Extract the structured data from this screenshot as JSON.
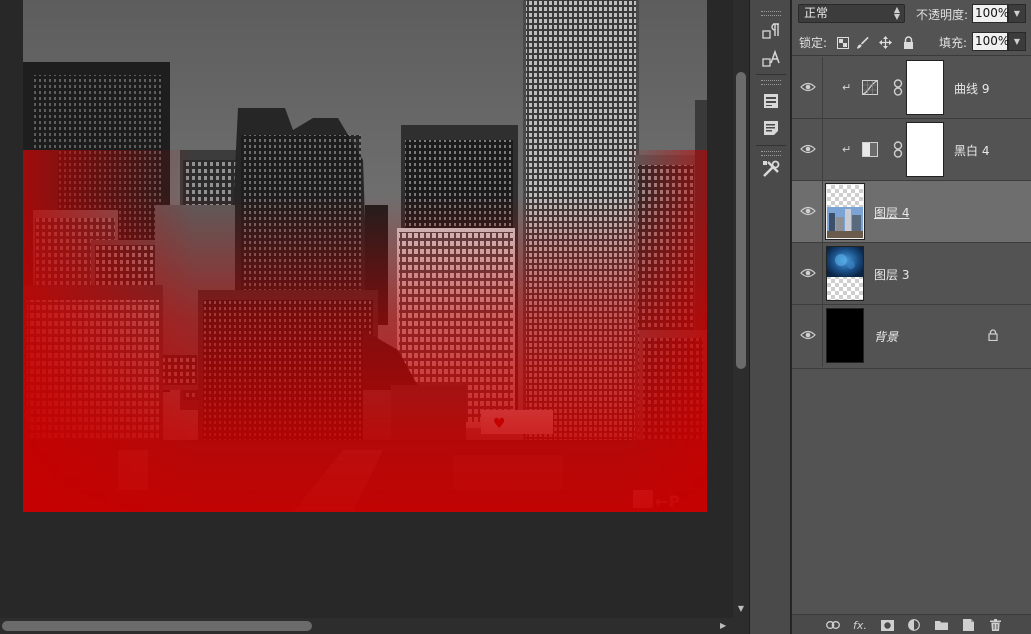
{
  "layers_panel": {
    "blend_mode": "正常",
    "opacity_label": "不透明度:",
    "opacity_value": "100%",
    "lock_label": "锁定:",
    "fill_label": "填充:",
    "fill_value": "100%",
    "layers": [
      {
        "name": "曲线 9",
        "kind": "adjustment",
        "adjustment": "curves-icon",
        "clipped": true
      },
      {
        "name": "黑白 4",
        "kind": "adjustment",
        "adjustment": "black-white-icon",
        "clipped": true
      },
      {
        "name": "图层 4",
        "kind": "pixel",
        "selected": true,
        "thumbnail": "city-photo"
      },
      {
        "name": "图层 3",
        "kind": "pixel",
        "thumbnail": "blue-cloud"
      },
      {
        "name": "背景",
        "kind": "background",
        "locked": true,
        "thumbnail": "black-fill"
      }
    ]
  },
  "tool_strip": {
    "tools": [
      "paragraph-icon",
      "character-icon",
      "layer-comps-icon",
      "notes-icon",
      "tool-presets-icon"
    ]
  },
  "canvas": {
    "billboard_text": "♥",
    "corner_sign": "←P"
  },
  "colors": {
    "panel_bg": "#535353",
    "selected_layer": "#6e6e6e",
    "workspace": "#282828",
    "red_overlay": "#c80000"
  }
}
